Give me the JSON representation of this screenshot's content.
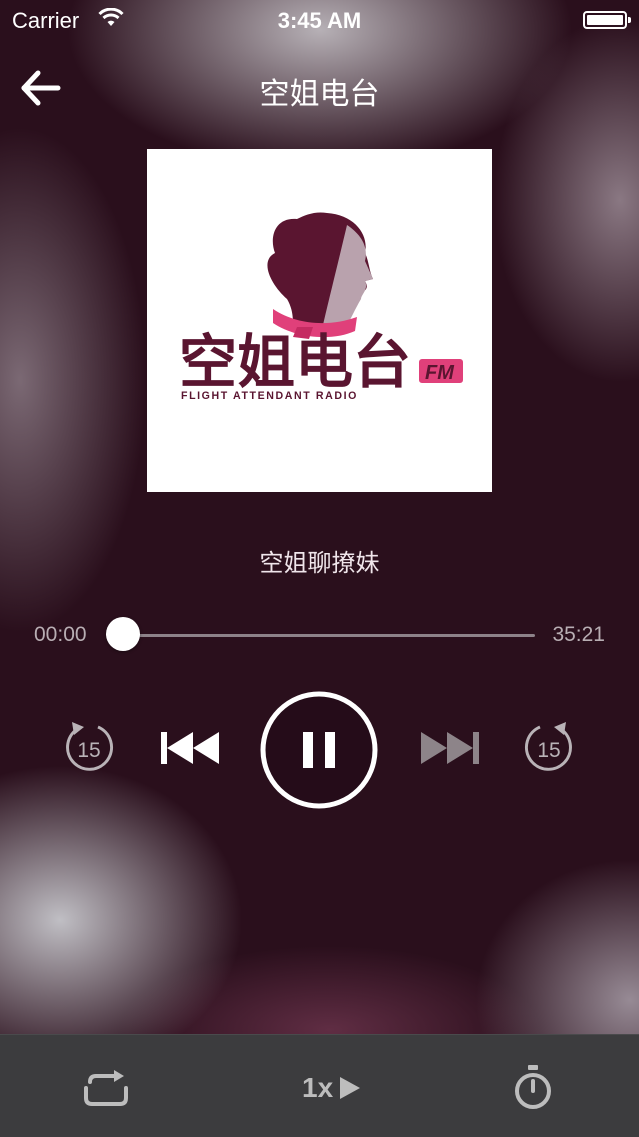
{
  "status_bar": {
    "carrier": "Carrier",
    "time": "3:45 AM"
  },
  "nav": {
    "title": "空姐电台"
  },
  "cover": {
    "logo_text": "空姐电台",
    "logo_badge": "FM",
    "logo_subtitle": "FLIGHT ATTENDANT RADIO",
    "brand_color": "#5a1530",
    "accent_color": "#e0407a"
  },
  "episode": {
    "title": "空姐聊撩妹"
  },
  "player": {
    "current_time": "00:00",
    "total_time": "35:21",
    "progress": 0,
    "skip_seconds": "15"
  },
  "bottom_bar": {
    "speed_label": "1x"
  },
  "icons": [
    "back-arrow-icon",
    "wifi-icon",
    "battery-icon",
    "replay-15-icon",
    "previous-icon",
    "pause-icon",
    "next-icon",
    "forward-15-icon",
    "loop-icon",
    "play-triangle-icon",
    "timer-icon"
  ]
}
